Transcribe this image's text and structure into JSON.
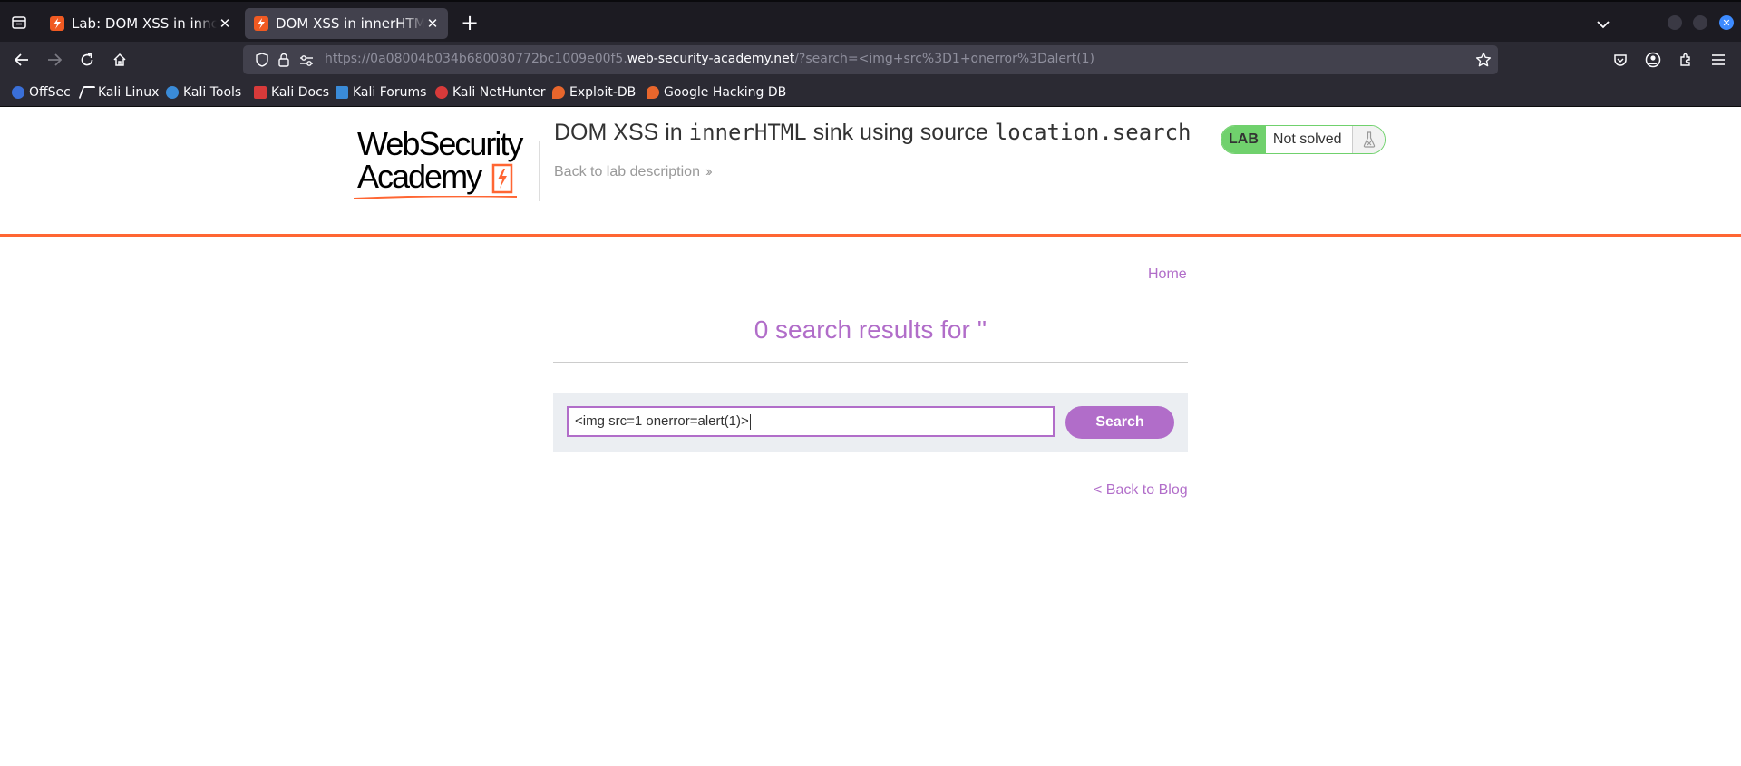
{
  "browser": {
    "tabs": [
      {
        "title": "Lab: DOM XSS in innerHTML sink using source location.search",
        "active": false
      },
      {
        "title": "DOM XSS in innerHTML sink using source location.search",
        "active": true
      }
    ],
    "url": {
      "prefix": "https://0a08004b034b680080772bc1009e00f5.",
      "host": "web-security-academy.net",
      "path": "/?search=<img+src%3D1+onerror%3Dalert(1)"
    },
    "bookmarks": [
      {
        "label": "OffSec",
        "icon": "offsec-icon",
        "color": "#3a6fd8"
      },
      {
        "label": "Kali Linux",
        "icon": "kali-dragon-icon",
        "color": "#fbfbfe"
      },
      {
        "label": "Kali Tools",
        "icon": "kali-tools-icon",
        "color": "#3a8bd8"
      },
      {
        "label": "Kali Docs",
        "icon": "kali-docs-icon",
        "color": "#d83a3a"
      },
      {
        "label": "Kali Forums",
        "icon": "kali-forums-icon",
        "color": "#3a8bd8"
      },
      {
        "label": "Kali NetHunter",
        "icon": "nethunter-icon",
        "color": "#d83a3a"
      },
      {
        "label": "Exploit-DB",
        "icon": "exploit-db-icon",
        "color": "#e8662c"
      },
      {
        "label": "Google Hacking DB",
        "icon": "ghdb-icon",
        "color": "#e8662c"
      }
    ]
  },
  "lab": {
    "logo_line1": "WebSecurity",
    "logo_line2": "Academy",
    "title_pre": "DOM XSS in ",
    "title_code1": "innerHTML",
    "title_mid": " sink using source ",
    "title_code2": "location.search",
    "back_to_description": "Back to lab description",
    "badge_label": "LAB",
    "badge_status": "Not solved",
    "accent_color": "#ff6633",
    "status_color": "#70d16d"
  },
  "blog": {
    "home_link": "Home",
    "results_heading": "0 search results for ''",
    "search_value": "<img src=1 onerror=alert(1)>",
    "search_button": "Search",
    "back_link": "< Back to Blog",
    "link_color": "#b16dc9"
  }
}
